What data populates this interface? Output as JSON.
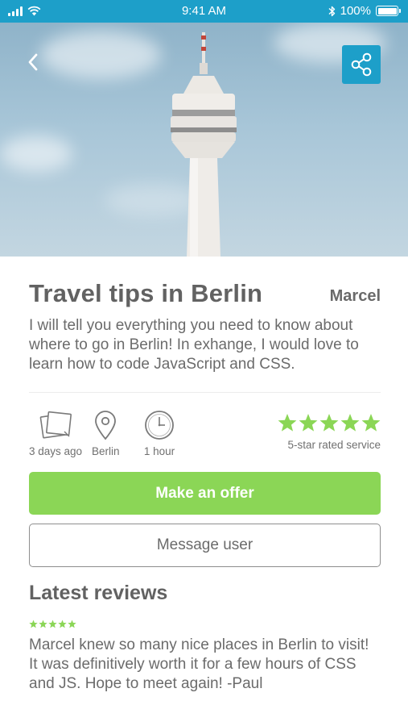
{
  "status_bar": {
    "time": "9:41 AM",
    "battery": "100%",
    "icons": [
      "signal-icon",
      "wifi-icon",
      "bluetooth-icon",
      "battery-icon"
    ]
  },
  "hero": {
    "image_subject": "TV tower against a cloudy sky",
    "back_icon": "chevron-left-icon",
    "share_icon": "share-icon"
  },
  "listing": {
    "title": "Travel tips in Berlin",
    "author": "Marcel",
    "description": "I will tell you everything you need to know about where to go in Berlin! In exhange, I would love to learn how to code JavaScript and CSS."
  },
  "meta": {
    "posted": "3 days ago",
    "location": "Berlin",
    "duration": "1 hour",
    "rating_label": "5-star rated service",
    "rating": 5
  },
  "actions": {
    "offer_label": "Make an offer",
    "message_label": "Message user"
  },
  "reviews": {
    "title": "Latest reviews",
    "items": [
      {
        "rating": 5,
        "text": "Marcel knew so many nice places in Berlin to visit! It was definitively worth it for a few hours of CSS and JS. Hope to meet again! -Paul"
      }
    ]
  },
  "colors": {
    "brand_blue": "#1d9fc9",
    "accent_green": "#8bd656",
    "text_gray": "#626262"
  }
}
